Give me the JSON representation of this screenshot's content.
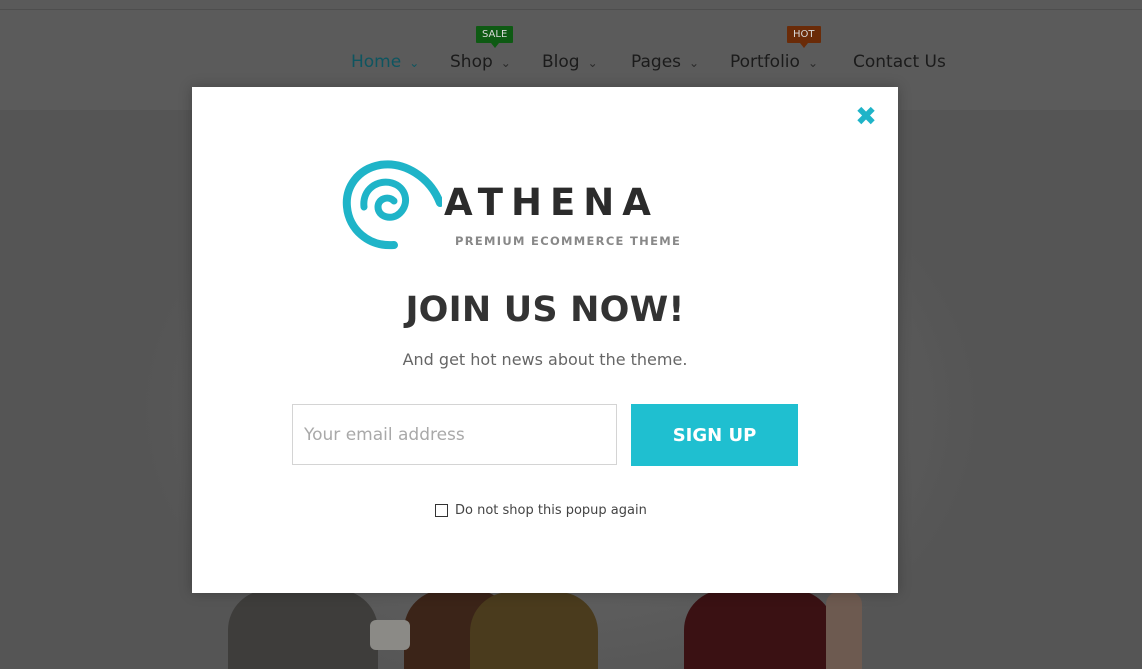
{
  "nav": {
    "items": [
      {
        "label": "Home"
      },
      {
        "label": "Shop"
      },
      {
        "label": "Blog"
      },
      {
        "label": "Pages"
      },
      {
        "label": "Portfolio"
      },
      {
        "label": "Contact Us"
      }
    ],
    "badges": {
      "sale": "SALE",
      "hot": "HOT"
    },
    "chevron": "⌄"
  },
  "popup": {
    "close_icon": "✖",
    "logo": {
      "word": "ATHENA",
      "tagline": "PREMIUM ECOMMERCE THEME"
    },
    "title": "JOIN US NOW!",
    "subtitle": "And get hot news about the theme.",
    "email_placeholder": "Your email address",
    "signup_label": "SIGN UP",
    "dont_show_label": "Do not shop this popup again"
  },
  "colors": {
    "accent": "#1fbfd0",
    "active_nav": "#0e5560",
    "sale_badge": "#0e5a13",
    "hot_badge": "#6a2b08"
  }
}
